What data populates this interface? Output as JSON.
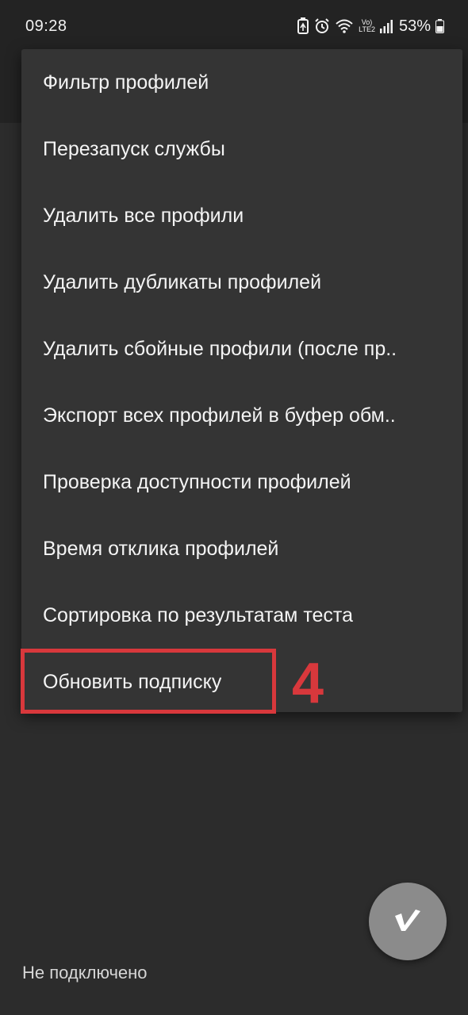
{
  "status_bar": {
    "time": "09:28",
    "battery_percent": "53%",
    "network_label_top": "Vo)",
    "network_label_bottom": "LTE2",
    "icons": [
      "battery-saver-icon",
      "alarm-icon",
      "wifi-icon",
      "volte-lte-icon",
      "signal-icon",
      "battery-icon"
    ]
  },
  "menu": {
    "items": [
      {
        "label": "Фильтр профилей"
      },
      {
        "label": "Перезапуск службы"
      },
      {
        "label": "Удалить все профили"
      },
      {
        "label": "Удалить дубликаты профилей"
      },
      {
        "label": "Удалить сбойные профили (после пр.."
      },
      {
        "label": "Экспорт всех профилей в буфер обм.."
      },
      {
        "label": "Проверка доступности профилей"
      },
      {
        "label": "Время отклика профилей"
      },
      {
        "label": "Сортировка по результатам теста"
      },
      {
        "label": "Обновить подписку"
      }
    ]
  },
  "annotation": {
    "step_number": "4",
    "color": "#d8383c"
  },
  "fab": {
    "icon": "v-logo-icon"
  },
  "footer": {
    "connection_status": "Не подключено"
  }
}
